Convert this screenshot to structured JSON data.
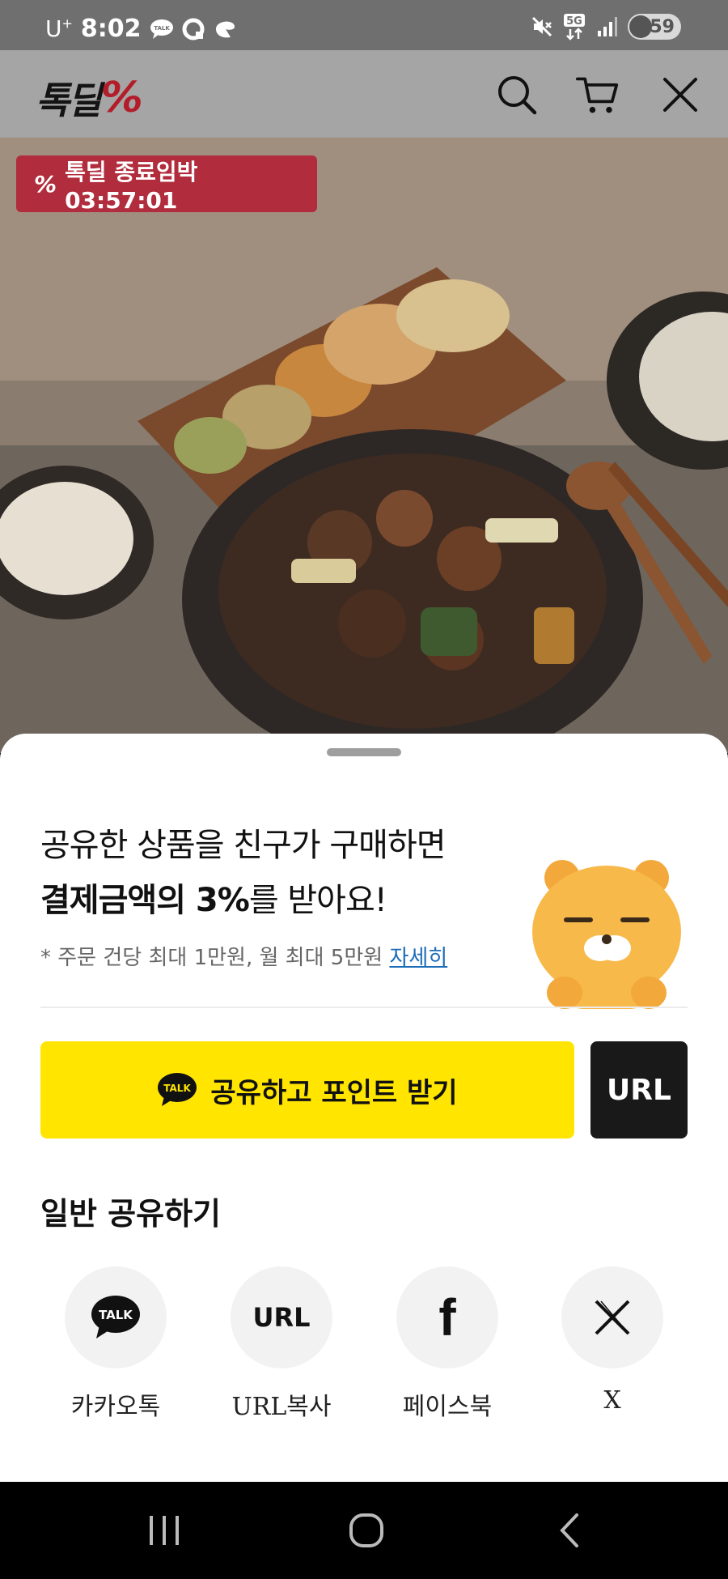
{
  "status_bar": {
    "carrier": "U",
    "carrier_sup": "+",
    "time": "8:02",
    "talk_badge": "TALK",
    "network": "5G",
    "battery": "59"
  },
  "header": {
    "logo_text": "톡딜",
    "logo_mark": "%"
  },
  "product": {
    "timer_label": "톡딜 종료임박 03:57:01",
    "timer_mark": "%"
  },
  "sheet": {
    "headline_line1": "공유한 상품을 친구가 구매하면",
    "headline_line2_bold": "결제금액의 3%",
    "headline_line2_rest": "를 받아요!",
    "note": "* 주문 건당 최대 1만원, 월 최대 5만원",
    "note_link": "자세히",
    "share_button_label": "공유하고 포인트 받기",
    "share_button_badge": "TALK",
    "url_button_label": "URL",
    "section_title": "일반 공유하기",
    "share_options": [
      {
        "label": "카카오톡",
        "icon_text": "TALK",
        "icon": "kakaotalk-icon"
      },
      {
        "label": "URL복사",
        "icon_text": "URL",
        "icon": "url-icon"
      },
      {
        "label": "페이스북",
        "icon_text": "f",
        "icon": "facebook-icon"
      },
      {
        "label": "X",
        "icon_text": "𝕏",
        "icon": "x-icon"
      }
    ]
  },
  "colors": {
    "kakao_yellow": "#ffe500",
    "badge_red": "#b12c3c",
    "link_blue": "#1a6bb8"
  }
}
